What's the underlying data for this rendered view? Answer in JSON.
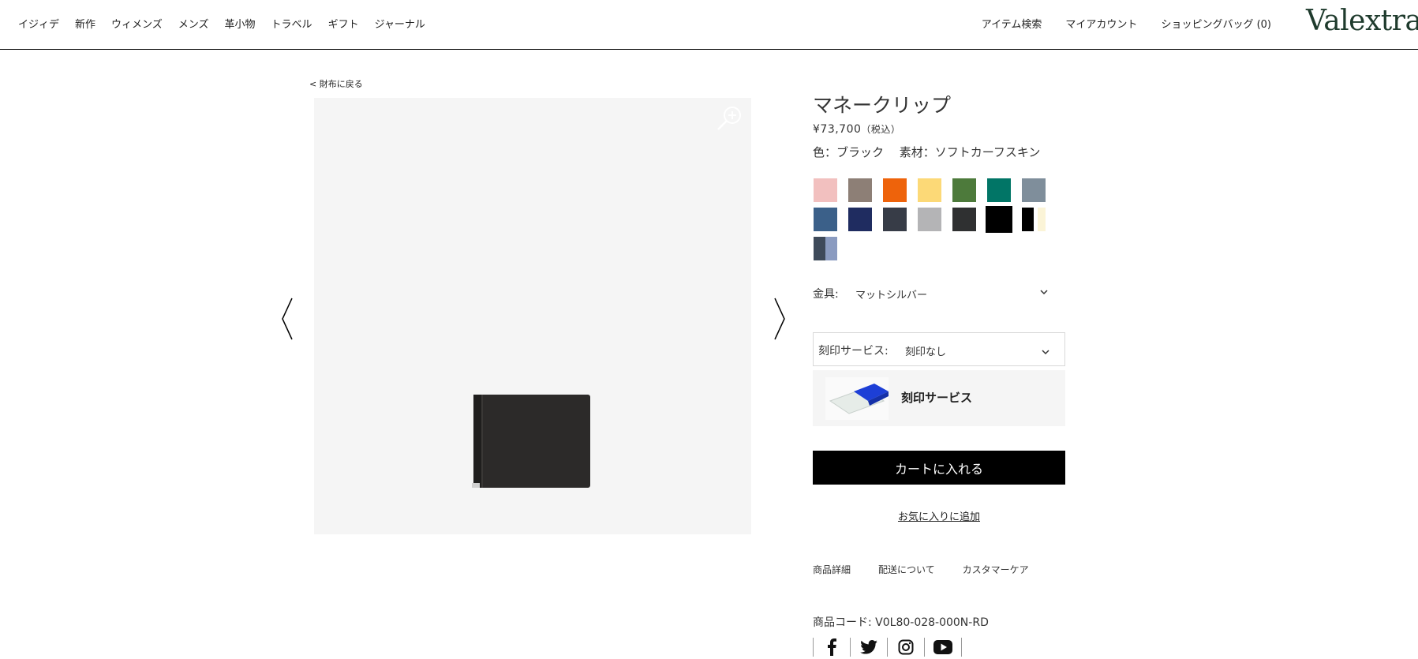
{
  "header": {
    "nav_left": [
      "イジィデ",
      "新作",
      "ウィメンズ",
      "メンズ",
      "革小物",
      "トラベル",
      "ギフト",
      "ジャーナル"
    ],
    "search": "アイテム検索",
    "account": "マイアカウント",
    "bag": "ショッピングバッグ (0)",
    "logo": "Valextra"
  },
  "breadcrumb": {
    "back": "< 財布に戻る"
  },
  "product": {
    "title": "マネークリップ",
    "price": "¥73,700",
    "tax_note": "（税込）",
    "color_material": "色：ブラック　 素材：ソフトカーフスキン",
    "swatches": [
      {
        "color": "#f2c0bf"
      },
      {
        "color": "#8d7f76"
      },
      {
        "color": "#ee630b"
      },
      {
        "color": "#fcd977"
      },
      {
        "color": "#4d7a3b"
      },
      {
        "color": "#017566"
      },
      {
        "color": "#7f8e9b"
      },
      {
        "color": "#3b6089"
      },
      {
        "color": "#1f2c60"
      },
      {
        "color": "#373c47"
      },
      {
        "color": "#b4b4b6"
      },
      {
        "color": "#2f3031"
      },
      {
        "color": "#000000",
        "selected": true
      },
      {
        "split": [
          "#000000",
          "#ffffff",
          "#fbf4d7"
        ]
      },
      {
        "split": [
          "#3e4a5a",
          "#8a9bc0"
        ]
      }
    ],
    "hardware_label": "金具:",
    "hardware_value": "マットシルバー",
    "engraving_label": "刻印サービス:",
    "engraving_value": "刻印なし",
    "engraving_card_title": "刻印サービス",
    "add_to_cart": "カートに入れる",
    "wishlist": "お気に入りに追加",
    "tabs": [
      "商品詳細",
      "配送について",
      "カスタマーケア"
    ],
    "product_code": "商品コード: V0L80-028-000N-RD",
    "social": [
      "facebook-icon",
      "twitter-icon",
      "instagram-icon",
      "youtube-icon"
    ]
  }
}
